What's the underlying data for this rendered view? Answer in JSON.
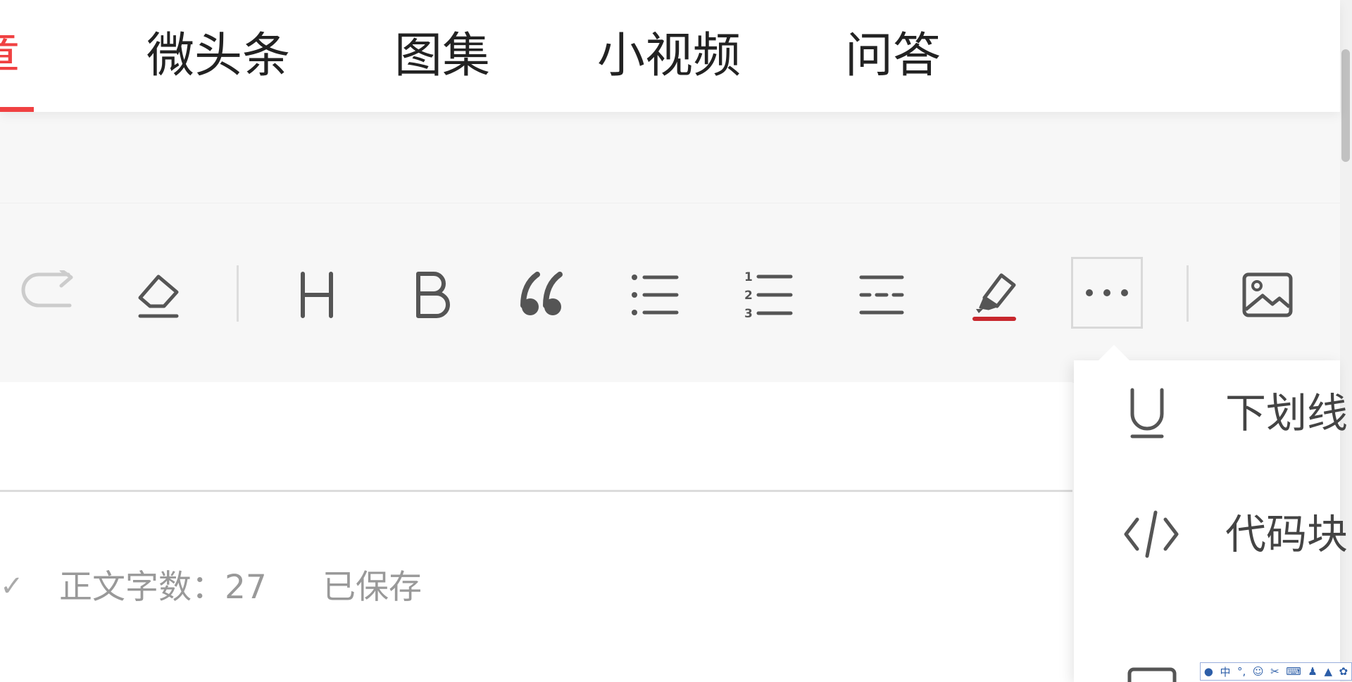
{
  "tabs": [
    {
      "label": "文章",
      "visible_label": "章",
      "active": true
    },
    {
      "label": "微头条"
    },
    {
      "label": "图集"
    },
    {
      "label": "小视频"
    },
    {
      "label": "问答"
    }
  ],
  "toolbar": {
    "icons": [
      "redo-icon",
      "eraser-icon",
      "heading-icon",
      "bold-icon",
      "quote-icon",
      "bullet-list-icon",
      "numbered-list-icon",
      "divider-icon",
      "highlight-icon",
      "more-icon",
      "image-icon"
    ],
    "more_active": true,
    "highlight_color": "#c8272d"
  },
  "status": {
    "word_count_label": "正文字数：27",
    "saved_label": "已保存"
  },
  "dropdown": {
    "items": [
      {
        "label": "下划线",
        "icon": "underline-icon"
      },
      {
        "label": "代码块",
        "icon": "code-block-icon"
      },
      {
        "label": "",
        "icon": "partial-icon"
      }
    ]
  },
  "ime": {
    "mode_label": "中",
    "icons": [
      "user-icon",
      "punctuation-icon",
      "emoji-icon",
      "scissors-icon",
      "keyboard-icon",
      "person-icon",
      "skin-icon",
      "settings-icon"
    ]
  },
  "colors": {
    "accent": "#f04142",
    "icon": "#555555",
    "disabled": "#cccccc"
  }
}
